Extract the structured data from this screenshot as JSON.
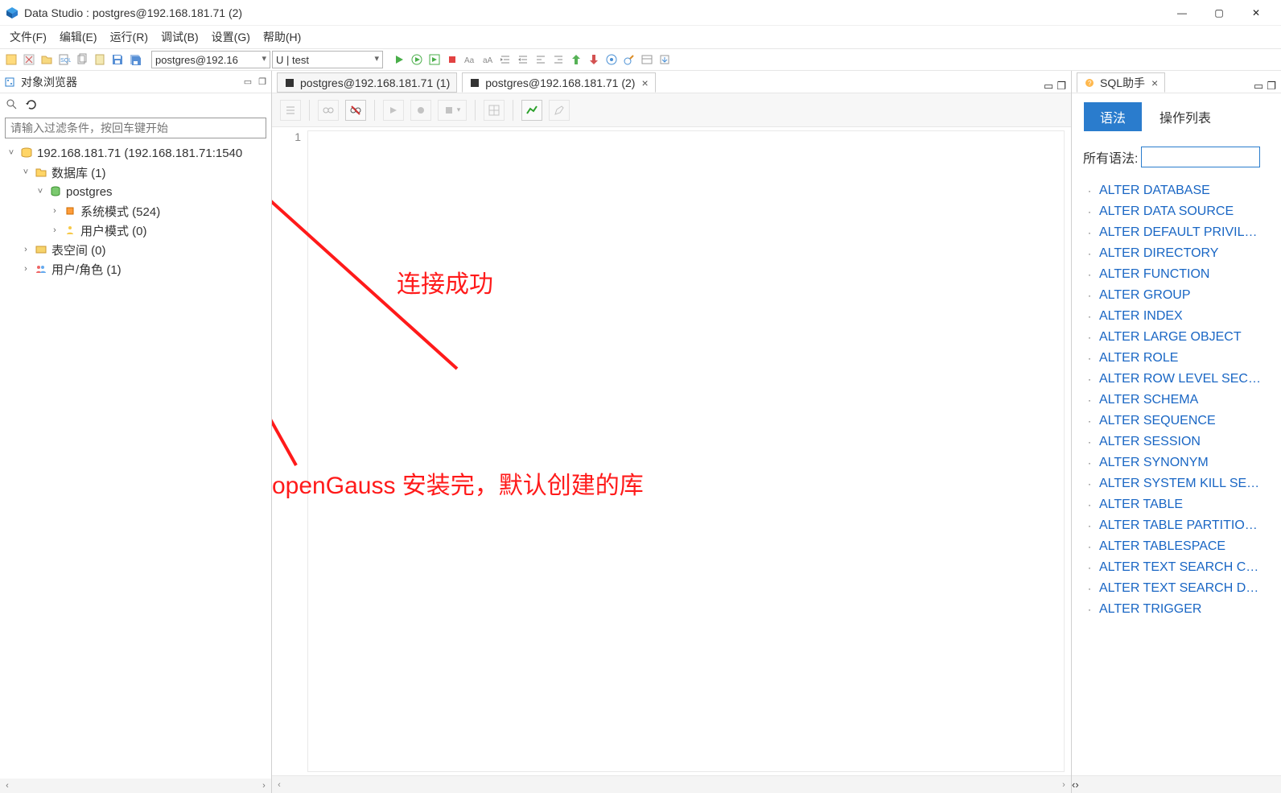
{
  "window": {
    "title": "Data Studio : postgres@192.168.181.71 (2)"
  },
  "menu": [
    "文件(F)",
    "编辑(E)",
    "运行(R)",
    "调试(B)",
    "设置(G)",
    "帮助(H)"
  ],
  "toolbar": {
    "conn_combo": "postgres@192.16",
    "schema_combo": "U | test"
  },
  "object_browser": {
    "title": "对象浏览器",
    "filter_placeholder": "请输入过滤条件，按回车键开始",
    "tree": {
      "server": "192.168.181.71 (192.168.181.71:1540",
      "databases": "数据库 (1)",
      "db_name": "postgres",
      "system_schema": "系统模式 (524)",
      "user_schema": "用户模式 (0)",
      "tablespaces": "表空间 (0)",
      "users_roles": "用户/角色 (1)"
    }
  },
  "editor": {
    "tabs": [
      {
        "label": "postgres@192.168.181.71 (1)"
      },
      {
        "label": "postgres@192.168.181.71 (2)"
      }
    ],
    "line_number": "1"
  },
  "annotations": {
    "connected": "连接成功",
    "default_db": "openGauss 安装完，默认创建的库"
  },
  "sql_helper": {
    "title": "SQL助手",
    "tabs": {
      "syntax": "语法",
      "ops": "操作列表"
    },
    "filter_label": "所有语法:",
    "items": [
      "ALTER DATABASE",
      "ALTER DATA SOURCE",
      "ALTER DEFAULT PRIVIL…",
      "ALTER DIRECTORY",
      "ALTER FUNCTION",
      "ALTER GROUP",
      "ALTER INDEX",
      "ALTER LARGE OBJECT",
      "ALTER ROLE",
      "ALTER ROW LEVEL SEC…",
      "ALTER SCHEMA",
      "ALTER SEQUENCE",
      "ALTER SESSION",
      "ALTER SYNONYM",
      "ALTER SYSTEM KILL SE…",
      "ALTER TABLE",
      "ALTER TABLE PARTITIO…",
      "ALTER TABLESPACE",
      "ALTER TEXT SEARCH C…",
      "ALTER TEXT SEARCH D…",
      "ALTER TRIGGER"
    ]
  }
}
